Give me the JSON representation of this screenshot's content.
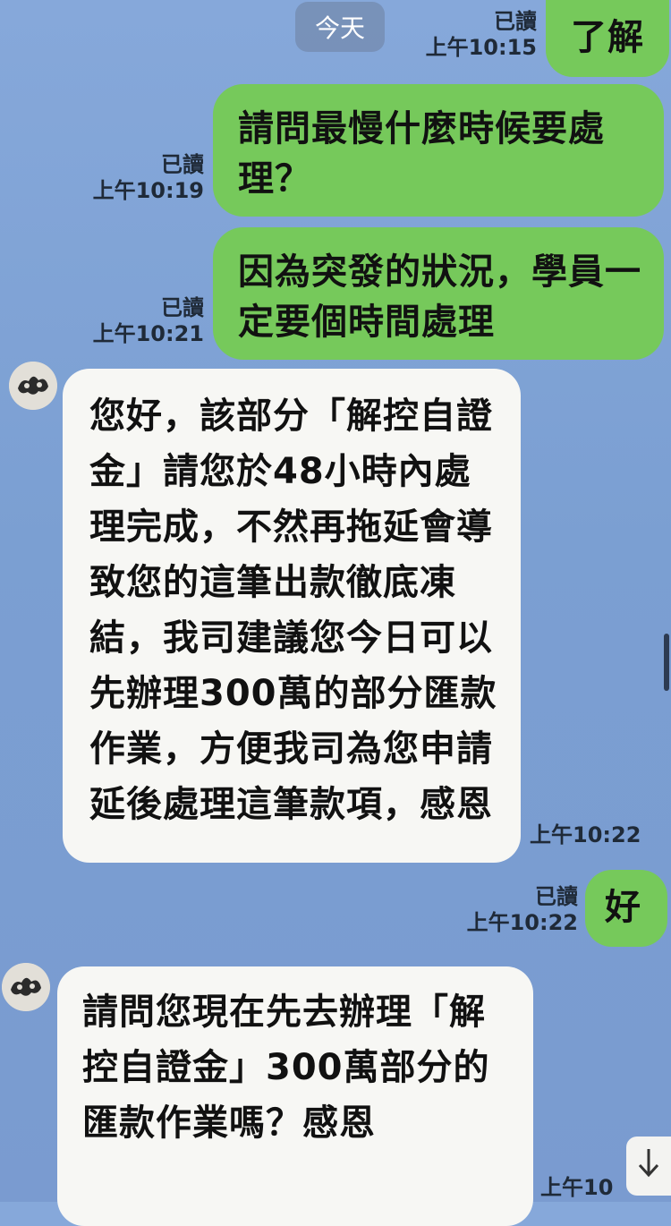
{
  "date_separator": "今天",
  "messages": [
    {
      "direction": "out",
      "text": "了解",
      "read": "已讀",
      "time": "上午10:15"
    },
    {
      "direction": "out",
      "text": "請問最慢什麼時候要處理？",
      "read": "已讀",
      "time": "上午10:19"
    },
    {
      "direction": "out",
      "text": "因為突發的狀況，學員一定要個時間處理",
      "read": "已讀",
      "time": "上午10:21"
    },
    {
      "direction": "in",
      "text": "您好，該部分「解控自證金」請您於48小時內處理完成，不然再拖延會導致您的這筆出款徹底凍結，我司建議您今日可以先辦理300萬的部分匯款作業，方便我司為您申請延後處理這筆款項，感恩",
      "time": "上午10:22"
    },
    {
      "direction": "out",
      "text": "好",
      "read": "已讀",
      "time": "上午10:22"
    },
    {
      "direction": "in",
      "text": "請問您現在先去辦理「解控自證金」300萬部分的匯款作業嗎？感恩",
      "time": "上午10"
    }
  ],
  "icons": {
    "scroll_down": "arrow-down-icon",
    "avatar": "avatar-icon"
  },
  "colors": {
    "outgoing_bubble": "#76c95b",
    "incoming_bubble": "#f7f7f4",
    "background": "#7b9fd4"
  }
}
